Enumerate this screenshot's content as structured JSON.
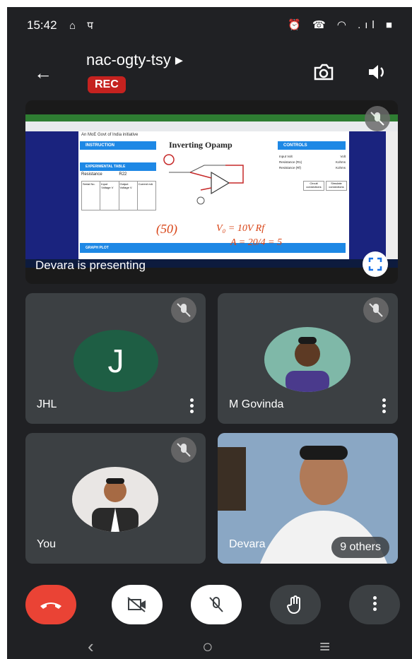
{
  "status_bar": {
    "time": "15:42",
    "left_icons": "⌂ प",
    "right_icons": "⏰ ☎ ◠ .ıl ■"
  },
  "header": {
    "meeting_code": "nac-ogty-tsy ▸",
    "rec_badge": "REC"
  },
  "presentation": {
    "presenter_text": "Devara is presenting",
    "slide_title": "Inverting Opamp",
    "panel_instruction": "INSTRUCTION",
    "panel_controls": "CONTROLS",
    "panel_experimental_table": "EXPERIMENTAL TABLE",
    "panel_graph_plot": "GRAPH PLOT",
    "resistance_label": "Resistance",
    "resistance_value": "R22",
    "table_headers": [
      "Serial No.",
      "Input Voltage V",
      "Output Voltage V",
      "Current mA"
    ],
    "control_labels": [
      "Input Volt",
      "Resistance (R1)",
      "Resistance (Rf)"
    ],
    "control_units": [
      "Volt",
      "Kohms",
      "Kohms"
    ],
    "buttons": [
      "Circuit connections",
      "Simulate connections"
    ],
    "site_caption": "An MoE Govt of India initiative",
    "handwriting": [
      "(50)",
      "V₀ = 10V Rf",
      "A = 20/4 = 5"
    ]
  },
  "participants": [
    {
      "name": "JHL",
      "avatar_letter": "J",
      "avatar_color": "#1e5e44"
    },
    {
      "name": "M Govinda"
    },
    {
      "name": "You"
    },
    {
      "name": "Devara",
      "others_label": "9 others"
    }
  ],
  "controls": {
    "end_call_color": "#ea4335"
  },
  "navigation": {
    "back": "‹",
    "home": "○",
    "recents": "≡"
  }
}
